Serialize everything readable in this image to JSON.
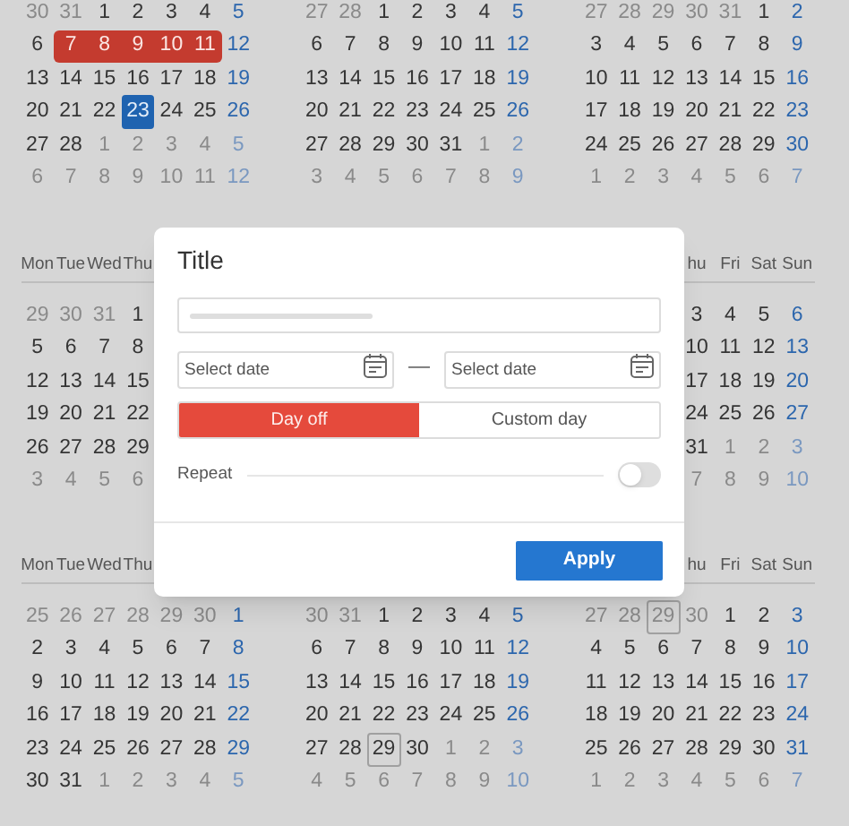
{
  "bands": [
    {
      "months": [
        {
          "kind": "full",
          "prev": [
            "30",
            "31"
          ],
          "days": [
            "1",
            "2",
            "3",
            "4",
            "5",
            "6",
            {
              "text": "7",
              "kind": "day_off"
            },
            {
              "text": "8",
              "kind": "day_off"
            },
            {
              "text": "9",
              "kind": "day_off"
            },
            {
              "text": "10",
              "kind": "day_off"
            },
            {
              "text": "11",
              "kind": "day_off"
            },
            "12",
            "13",
            "14",
            "15",
            "16",
            "17",
            "18",
            "19",
            "20",
            "21",
            "22",
            {
              "text": "23",
              "kind": "selected"
            },
            "24",
            "25",
            "26",
            "27",
            "28"
          ],
          "next": [
            "1",
            "2",
            "3",
            "4",
            "5",
            "6",
            "7",
            "8",
            "9",
            "10",
            "11",
            "12"
          ]
        },
        {
          "kind": "full",
          "prev": [
            "27",
            "28"
          ],
          "days": [
            "1",
            "2",
            "3",
            "4",
            "5",
            "6",
            "7",
            "8",
            "9",
            "10",
            "11",
            "12",
            "13",
            "14",
            "15",
            "16",
            "17",
            "18",
            "19",
            "20",
            "21",
            "22",
            "23",
            "24",
            "25",
            "26",
            "27",
            "28",
            "29",
            "30",
            "31"
          ],
          "next": [
            "1",
            "2",
            "3",
            "4",
            "5",
            "6",
            "7",
            "8",
            "9"
          ]
        },
        {
          "kind": "full",
          "prev": [
            "27",
            "28",
            "29",
            "30",
            "31"
          ],
          "days": [
            "1",
            "2",
            "3",
            "4",
            "5",
            "6",
            "7",
            "8",
            "9",
            "10",
            "11",
            "12",
            "13",
            "14",
            "15",
            "16",
            "17",
            "18",
            "19",
            "20",
            "21",
            "22",
            "23",
            "24",
            "25",
            "26",
            "27",
            "28",
            "29",
            "30"
          ],
          "next": [
            "1",
            "2",
            "3",
            "4",
            "5",
            "6",
            "7"
          ]
        }
      ]
    },
    {
      "months": [
        {
          "kind": "left_part",
          "weekdays": {
            "kind": "left_part",
            "labels": [
              "Mon",
              "Tue",
              "Wed",
              "Thu"
            ]
          },
          "weeks": [
            {
              "prev": [
                "29",
                "30",
                "31"
              ],
              "days": [
                "1"
              ]
            },
            {
              "days": [
                "5",
                "6",
                "7",
                "8"
              ]
            },
            {
              "days": [
                "12",
                "13",
                "14",
                "15"
              ]
            },
            {
              "days": [
                "19",
                "20",
                "21",
                "22"
              ]
            },
            {
              "days": [
                "26",
                "27",
                "28",
                "29"
              ]
            },
            {
              "next": [
                "3",
                "4",
                "5",
                "6"
              ]
            }
          ]
        },
        {
          "kind": "hidden"
        },
        {
          "kind": "right_part",
          "weekdays": {
            "kind": "right_part",
            "labels": [
              "hu",
              "Fri",
              "Sat",
              "Sun"
            ]
          },
          "weeks": [
            {
              "days": [
                "3",
                "4",
                "5",
                "6"
              ]
            },
            {
              "days": [
                "10",
                "11",
                "12",
                "13"
              ]
            },
            {
              "days": [
                "17",
                "18",
                "19",
                "20"
              ]
            },
            {
              "days": [
                "24",
                "25",
                "26",
                "27"
              ]
            },
            {
              "days": [
                "31"
              ],
              "next": [
                "1",
                "2",
                "3"
              ]
            },
            {
              "next": [
                "7",
                "8",
                "9",
                "10"
              ]
            }
          ]
        }
      ]
    },
    {
      "months": [
        {
          "kind": "full",
          "weekdays": {
            "kind": "left_part",
            "labels": [
              "Mon",
              "Tue",
              "Wed",
              "Thu"
            ]
          },
          "prev": [
            "25",
            "26",
            "27",
            "28",
            "29",
            "30"
          ],
          "days": [
            "1",
            "2",
            "3",
            "4",
            "5",
            "6",
            "7",
            "8",
            "9",
            "10",
            "11",
            "12",
            "13",
            "14",
            "15",
            "16",
            "17",
            "18",
            "19",
            "20",
            "21",
            "22",
            "23",
            "24",
            "25",
            "26",
            "27",
            "28",
            "29",
            "30",
            "31"
          ],
          "next": [
            "1",
            "2",
            "3",
            "4",
            "5"
          ]
        },
        {
          "kind": "full",
          "prev": [
            "30",
            "31"
          ],
          "days": [
            "1",
            "2",
            "3",
            "4",
            "5",
            "6",
            "7",
            "8",
            "9",
            "10",
            "11",
            "12",
            "13",
            "14",
            "15",
            "16",
            "17",
            "18",
            "19",
            "20",
            "21",
            "22",
            "23",
            "24",
            "25",
            "26",
            "27",
            "28",
            {
              "text": "29",
              "kind": "outlined"
            },
            "30"
          ],
          "next": [
            "1",
            "2",
            "3",
            "4",
            "5",
            "6",
            "7",
            "8",
            "9",
            "10"
          ]
        },
        {
          "kind": "full",
          "weekdays": {
            "kind": "right_part",
            "labels": [
              "hu",
              "Fri",
              "Sat",
              "Sun"
            ]
          },
          "prev": [
            "27",
            "28",
            {
              "text": "29",
              "kind": "outlined"
            },
            "30"
          ],
          "days": [
            "1",
            "2",
            "3",
            "4",
            "5",
            "6",
            "7",
            "8",
            "9",
            "10",
            "11",
            "12",
            "13",
            "14",
            "15",
            "16",
            "17",
            "18",
            "19",
            "20",
            "21",
            "22",
            "23",
            "24",
            "25",
            "26",
            "27",
            "28",
            "29",
            "30",
            "31"
          ],
          "next": [
            "1",
            "2",
            "3",
            "4",
            "5",
            "6",
            "7"
          ]
        }
      ]
    }
  ],
  "dialog": {
    "title": "Title",
    "date_fields": [
      {
        "placeholder": "Select date"
      },
      {
        "placeholder": "Select date"
      }
    ],
    "separator": "—",
    "segments": [
      {
        "label": "Day off",
        "selected": true
      },
      {
        "label": "Custom day",
        "selected": false
      }
    ],
    "repeat": {
      "label": "Repeat",
      "on": false
    },
    "button": "Apply"
  }
}
